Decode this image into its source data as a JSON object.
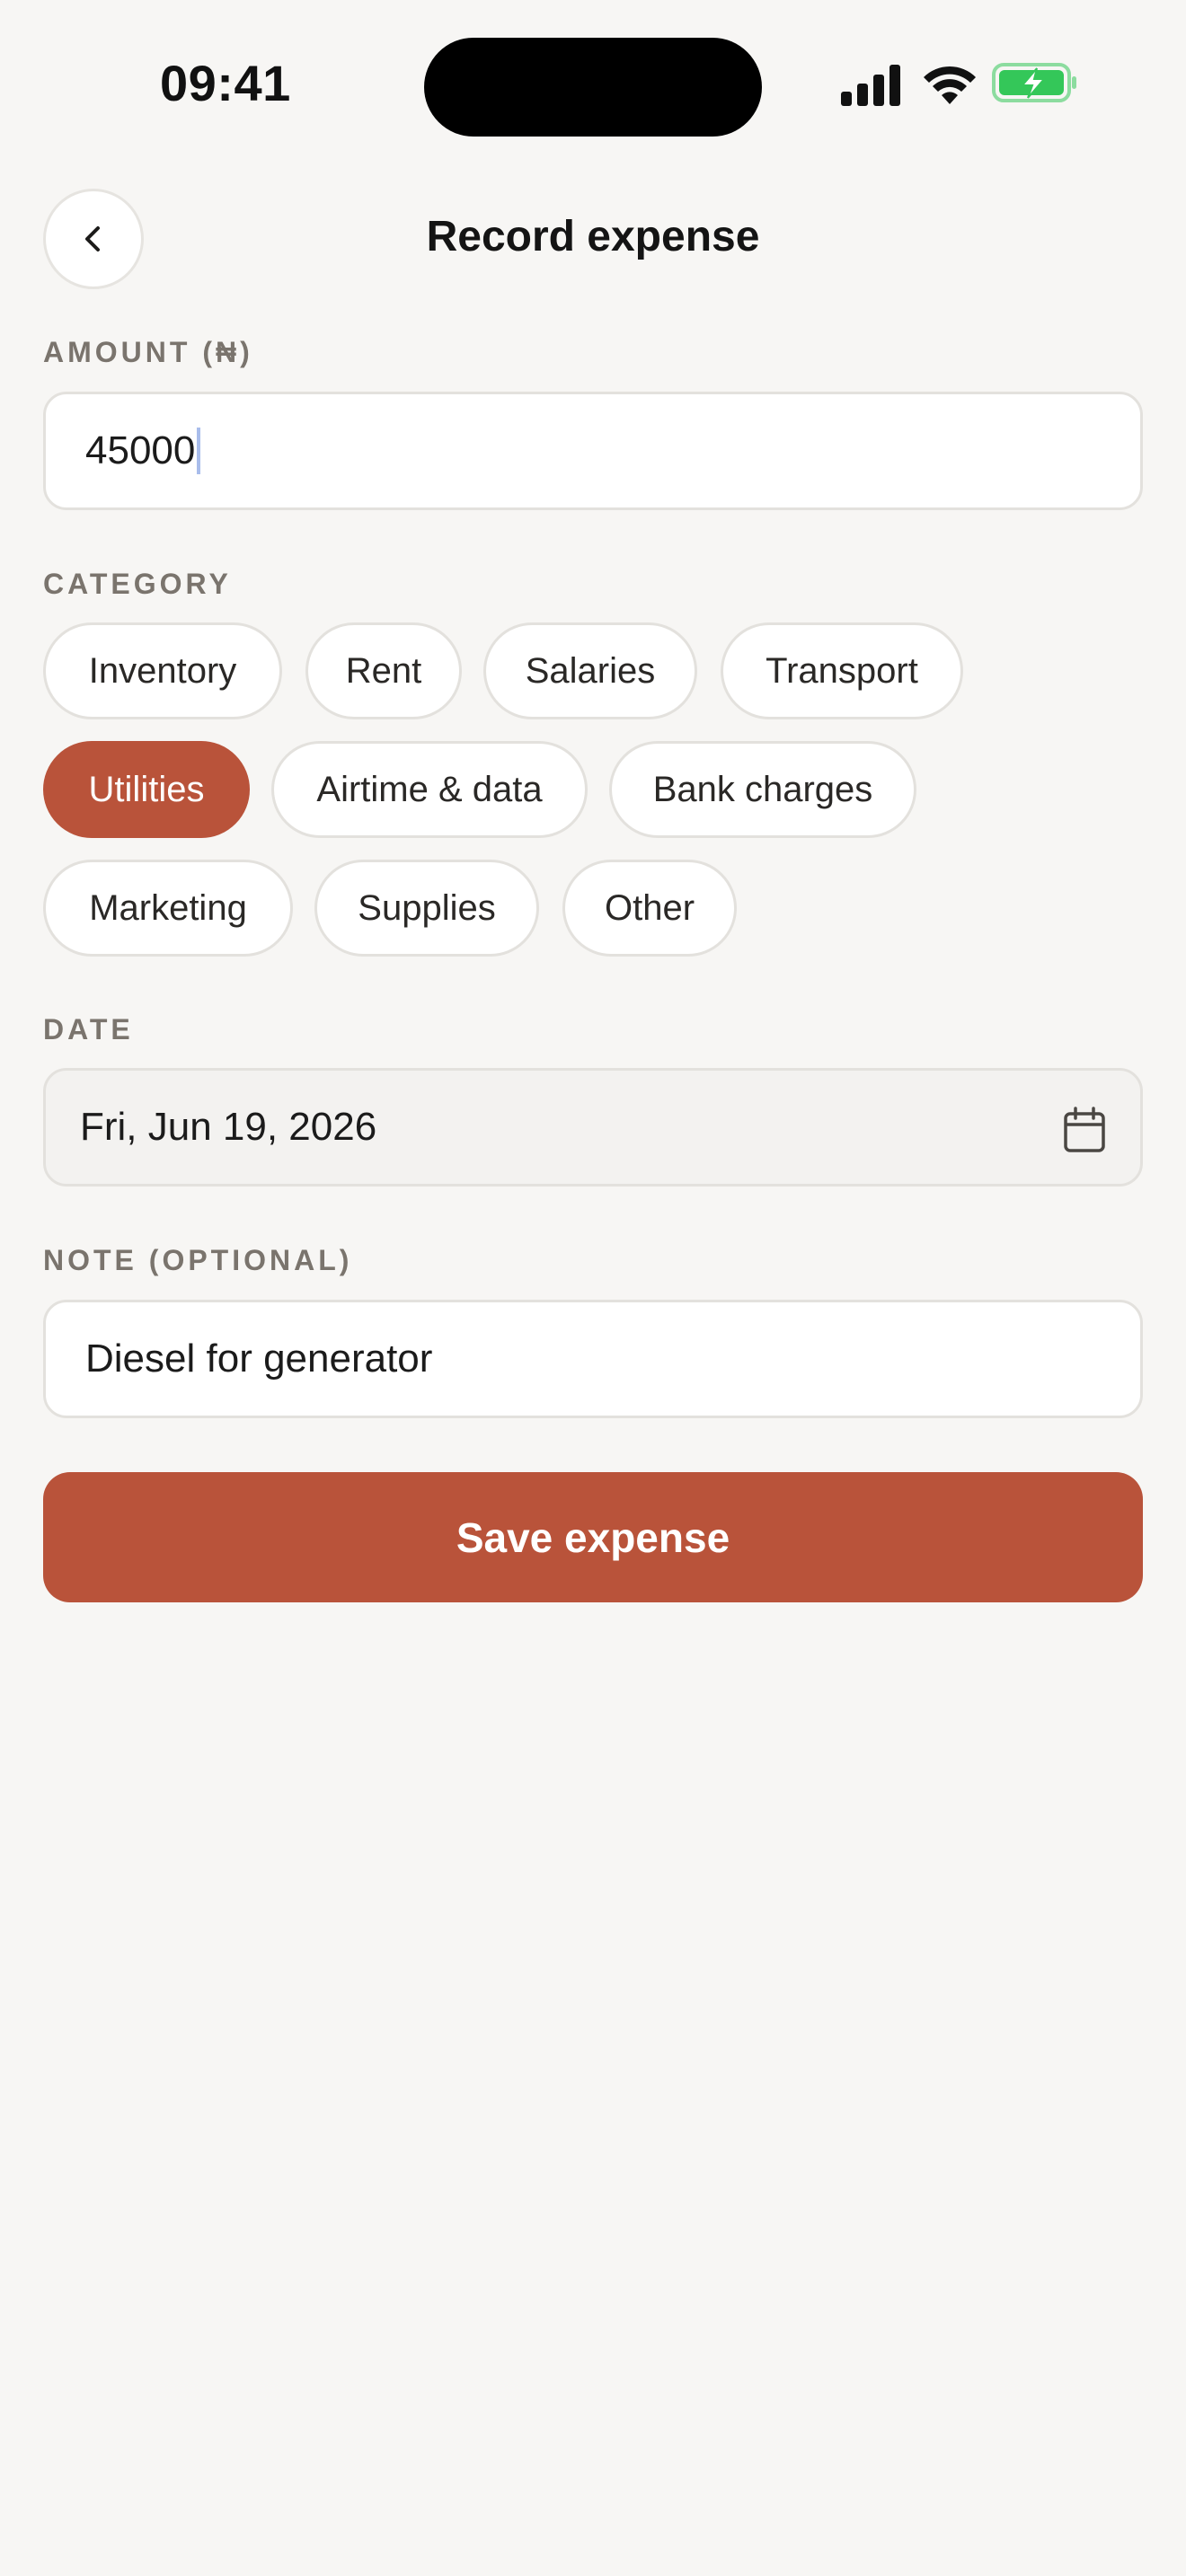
{
  "status_bar": {
    "time": "09:41",
    "icons": [
      "signal-icon",
      "wifi-icon",
      "battery-charging-icon"
    ]
  },
  "header": {
    "title": "Record expense",
    "back_icon": "chevron-left-icon"
  },
  "amount": {
    "label": "AMOUNT (₦)",
    "value": "45000"
  },
  "category": {
    "label": "CATEGORY",
    "selected": "Utilities",
    "options": [
      "Inventory",
      "Rent",
      "Salaries",
      "Transport",
      "Utilities",
      "Airtime & data",
      "Bank charges",
      "Marketing",
      "Supplies",
      "Other"
    ]
  },
  "date": {
    "label": "DATE",
    "value": "Fri, Jun 19, 2026",
    "icon": "calendar-icon"
  },
  "note": {
    "label": "NOTE (OPTIONAL)",
    "value": "Diesel for generator"
  },
  "actions": {
    "save_label": "Save expense"
  },
  "colors": {
    "accent": "#B9533A",
    "background": "#F7F6F4",
    "battery_green": "#34C759"
  }
}
